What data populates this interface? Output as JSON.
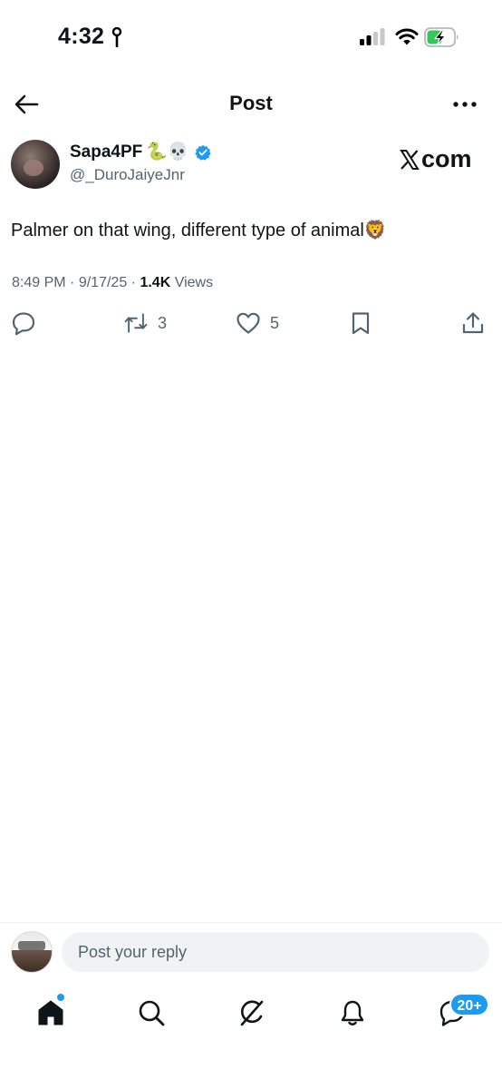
{
  "status_bar": {
    "time": "4:32",
    "icons": [
      "location-pin-icon",
      "cellular-signal-icon",
      "wifi-icon",
      "battery-charging-icon"
    ]
  },
  "header": {
    "title": "Post",
    "back_icon": "arrow-left-icon",
    "more_icon": "more-horizontal-icon"
  },
  "post": {
    "author": {
      "name": "Sapa4PF",
      "name_emojis": "🐍💀",
      "handle": "@_DuroJaiyeJnr",
      "verified": true
    },
    "watermark": "com",
    "text": "Palmer on that wing, different type of animal🦁",
    "time": "8:49 PM",
    "date": "9/17/25",
    "views_count": "1.4K",
    "views_label": " Views"
  },
  "actions": {
    "reply_count": "",
    "repost_count": "3",
    "like_count": "5",
    "bookmark_count": "",
    "share_count": ""
  },
  "reply": {
    "placeholder": "Post your reply"
  },
  "bottom_nav": {
    "items": [
      "home-icon",
      "search-icon",
      "grok-icon",
      "notifications-icon",
      "messages-icon"
    ],
    "messages_badge": "20+"
  },
  "colors": {
    "accent": "#1d9bf0",
    "text": "#0f1419",
    "secondary_text": "#536471",
    "battery_green": "#34c759"
  }
}
